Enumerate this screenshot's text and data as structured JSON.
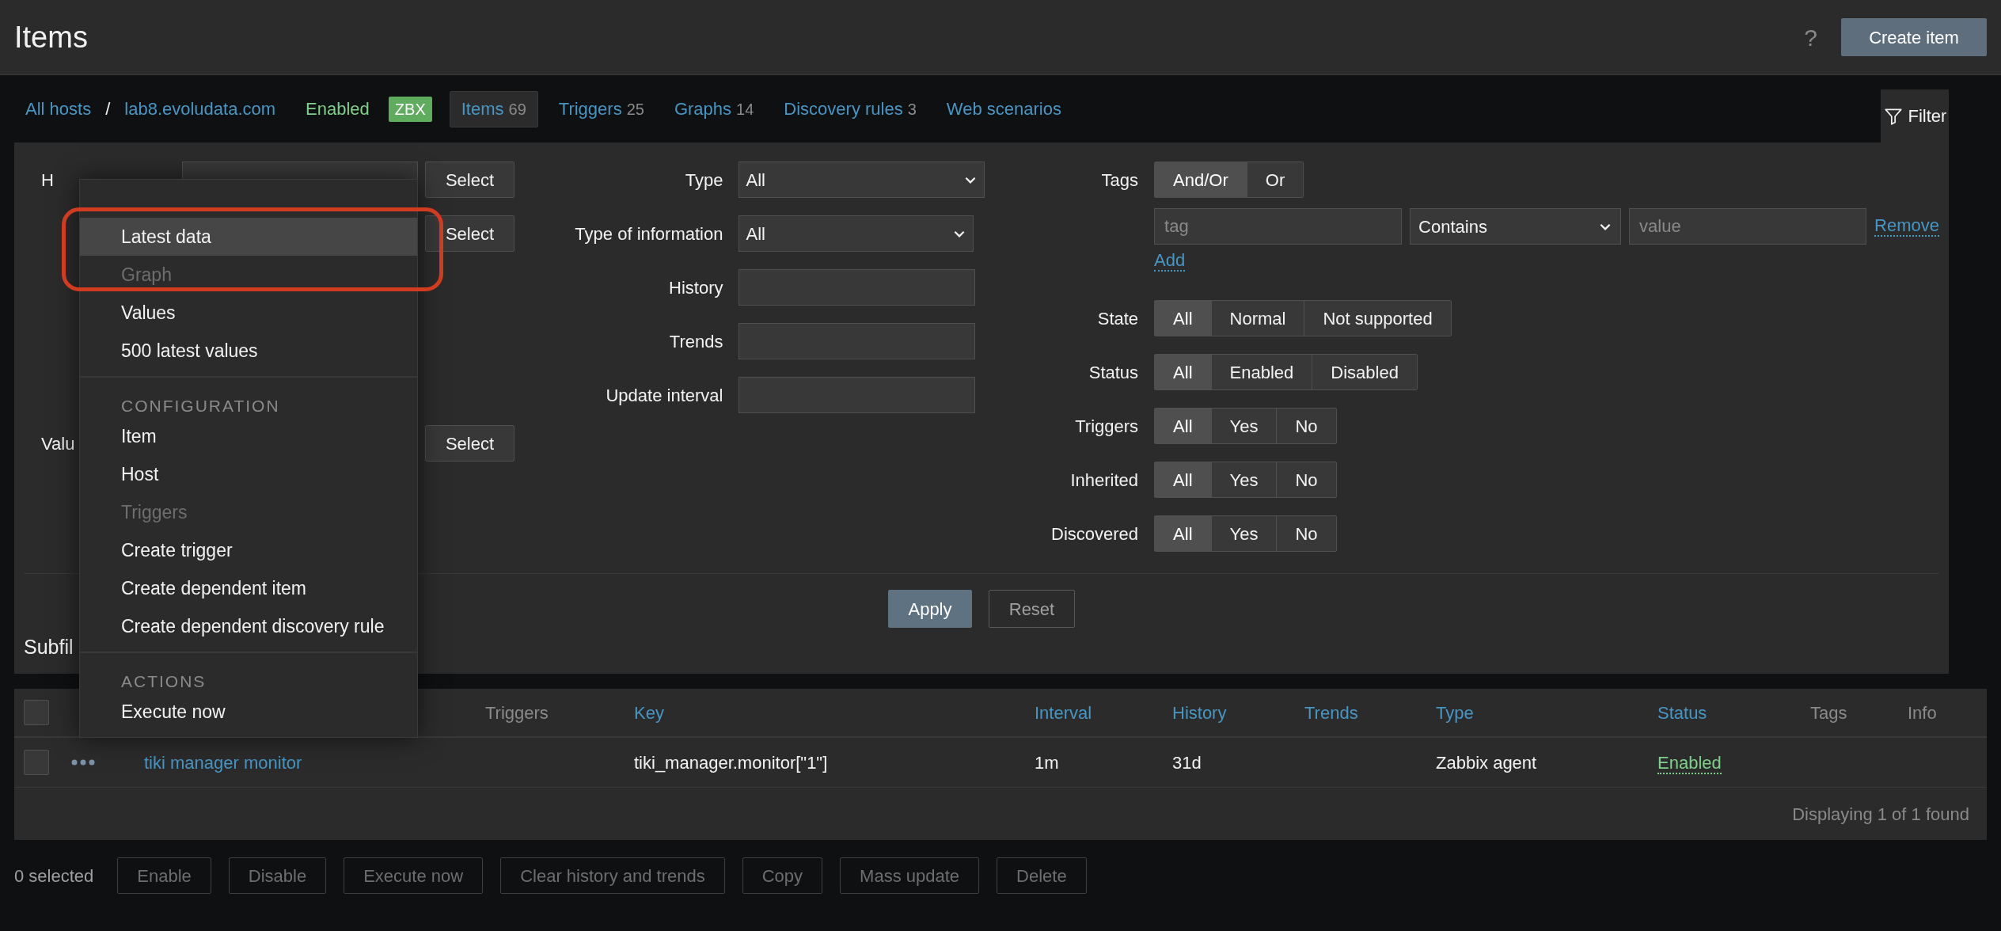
{
  "header": {
    "title": "Items",
    "help": "?",
    "create_button": "Create item"
  },
  "breadcrumbs": {
    "items": [
      "All hosts",
      "lab8.evoludata.com"
    ],
    "separator": "/"
  },
  "host_status": {
    "label": "Enabled",
    "badge": "ZBX"
  },
  "host_tabs": [
    {
      "label": "Items",
      "count": "69",
      "selected": true
    },
    {
      "label": "Triggers",
      "count": "25",
      "selected": false
    },
    {
      "label": "Graphs",
      "count": "14",
      "selected": false
    },
    {
      "label": "Discovery rules",
      "count": "3",
      "selected": false
    },
    {
      "label": "Web scenarios",
      "selected": false
    }
  ],
  "filter_tab": {
    "label": "Filter"
  },
  "filter": {
    "left": [
      {
        "label": "H",
        "button": "Select"
      },
      {
        "button": "Select"
      },
      {
        "label": "Valu",
        "button": "Select"
      }
    ],
    "middle": [
      {
        "label": "Type",
        "kind": "select",
        "value": "All"
      },
      {
        "label": "Type of information",
        "kind": "select",
        "value": "All"
      },
      {
        "label": "History",
        "kind": "input"
      },
      {
        "label": "Trends",
        "kind": "input"
      },
      {
        "label": "Update interval",
        "kind": "input"
      }
    ],
    "tags": {
      "label": "Tags",
      "options": [
        {
          "label": "And/Or",
          "selected": true
        },
        {
          "label": "Or",
          "selected": false
        }
      ],
      "tag_placeholder": "tag",
      "operator": "Contains",
      "value_placeholder": "value",
      "remove": "Remove",
      "add": "Add"
    },
    "toggles": [
      {
        "label": "State",
        "options": [
          {
            "label": "All",
            "selected": true
          },
          {
            "label": "Normal",
            "selected": false
          },
          {
            "label": "Not supported",
            "selected": false
          }
        ]
      },
      {
        "label": "Status",
        "options": [
          {
            "label": "All",
            "selected": true
          },
          {
            "label": "Enabled",
            "selected": false
          },
          {
            "label": "Disabled",
            "selected": false
          }
        ]
      },
      {
        "label": "Triggers",
        "options": [
          {
            "label": "All",
            "selected": true
          },
          {
            "label": "Yes",
            "selected": false
          },
          {
            "label": "No",
            "selected": false
          }
        ]
      },
      {
        "label": "Inherited",
        "options": [
          {
            "label": "All",
            "selected": true
          },
          {
            "label": "Yes",
            "selected": false
          },
          {
            "label": "No",
            "selected": false
          }
        ]
      },
      {
        "label": "Discovered",
        "options": [
          {
            "label": "All",
            "selected": true
          },
          {
            "label": "Yes",
            "selected": false
          },
          {
            "label": "No",
            "selected": false
          }
        ]
      }
    ],
    "apply": "Apply",
    "reset": "Reset"
  },
  "subfilter": {
    "title": "Subfil"
  },
  "table": {
    "select_all_checked": false,
    "columns": [
      {
        "label": "Triggers",
        "sortable": false
      },
      {
        "label": "Key",
        "sortable": true
      },
      {
        "label": "Interval",
        "sortable": true
      },
      {
        "label": "History",
        "sortable": true
      },
      {
        "label": "Trends",
        "sortable": true
      },
      {
        "label": "Type",
        "sortable": true
      },
      {
        "label": "Status",
        "sortable": true
      },
      {
        "label": "Tags",
        "sortable": false
      },
      {
        "label": "Info",
        "sortable": false
      }
    ],
    "rows": [
      {
        "checked": false,
        "name": "tiki manager monitor",
        "key": "tiki_manager.monitor[\"1\"]",
        "interval": "1m",
        "history": "31d",
        "type": "Zabbix agent",
        "status": "Enabled"
      }
    ],
    "footer": "Displaying 1 of 1 found"
  },
  "selection": {
    "count": "0 selected",
    "actions": [
      {
        "label": "Enable",
        "disabled": true
      },
      {
        "label": "Disable",
        "disabled": true
      },
      {
        "label": "Execute now",
        "disabled": true
      },
      {
        "label": "Clear history and trends",
        "disabled": true
      },
      {
        "label": "Copy",
        "disabled": true
      },
      {
        "label": "Mass update",
        "disabled": true
      },
      {
        "label": "Delete",
        "disabled": true
      }
    ]
  },
  "context_menu": {
    "sections": [
      {
        "items": [
          {
            "label": "Latest data",
            "disabled": false,
            "selected": true
          },
          {
            "label": "Graph",
            "disabled": true,
            "selected": false
          },
          {
            "label": "Values",
            "disabled": false,
            "selected": false
          },
          {
            "label": "500 latest values",
            "disabled": false,
            "selected": false
          }
        ]
      },
      {
        "title": "CONFIGURATION",
        "items": [
          {
            "label": "Item",
            "disabled": false,
            "selected": false
          },
          {
            "label": "Host",
            "disabled": false,
            "selected": false
          },
          {
            "label": "Triggers",
            "disabled": true,
            "selected": false
          },
          {
            "label": "Create trigger",
            "disabled": false,
            "selected": false
          },
          {
            "label": "Create dependent item",
            "disabled": false,
            "selected": false
          },
          {
            "label": "Create dependent discovery rule",
            "disabled": false,
            "selected": false
          }
        ]
      },
      {
        "title": "ACTIONS",
        "items": [
          {
            "label": "Execute now",
            "disabled": false,
            "selected": false
          }
        ]
      }
    ]
  }
}
